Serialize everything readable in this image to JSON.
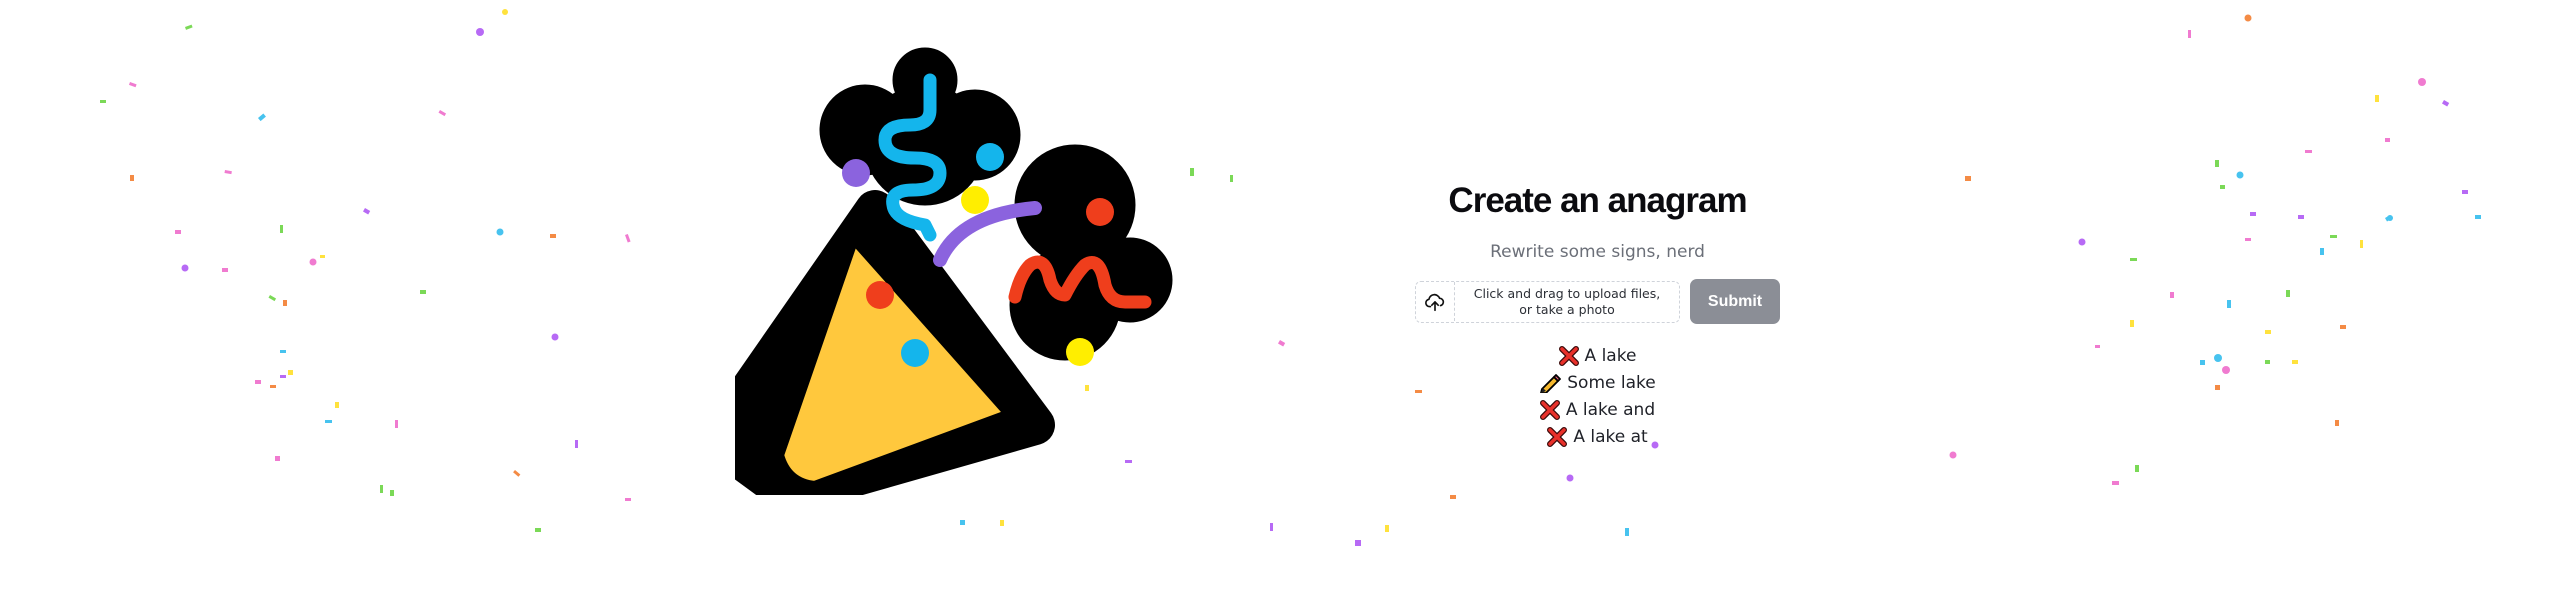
{
  "page": {
    "title": "Create an anagram",
    "subtitle": "Rewrite some signs, nerd"
  },
  "upload": {
    "icon": "cloud-upload-icon",
    "text_line1": "Click and drag to upload files,",
    "text_line2": "or take a photo"
  },
  "submit": {
    "label": "Submit",
    "color": "#8b8e96"
  },
  "results": [
    {
      "status": "cross-mark",
      "text": "A lake"
    },
    {
      "status": "pencil",
      "text": "Some lake"
    },
    {
      "status": "cross-mark",
      "text": "A lake and"
    },
    {
      "status": "cross-mark",
      "text": "A lake at"
    }
  ],
  "decor": {
    "hero_icon": "party-popper-icon",
    "background": "confetti",
    "colors": {
      "cone": "#ffc83d",
      "outline": "#000000",
      "red": "#ef3e1c",
      "blue": "#14b5ec",
      "purple": "#8b63de",
      "yellow": "#ffee00"
    }
  }
}
